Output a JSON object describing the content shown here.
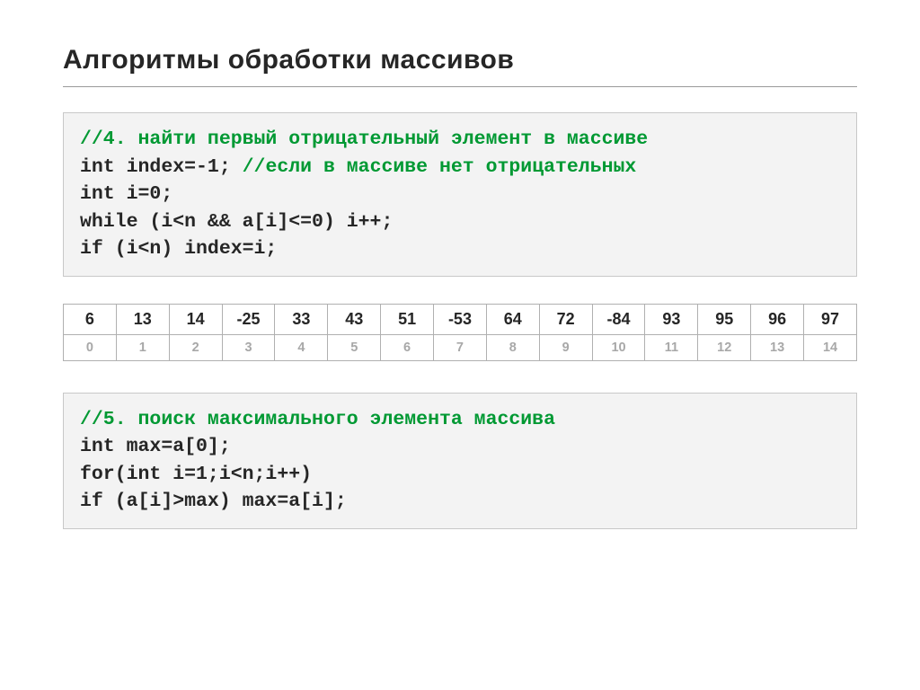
{
  "title": "Алгоритмы обработки массивов",
  "code_block_1": {
    "line1": {
      "comment": "//4. найти первый отрицательный элемент в массиве"
    },
    "line2": {
      "pre": "int index=-1; ",
      "comment": "//если в массиве нет отрицательных"
    },
    "line3": "int i=0;",
    "line4": "while (i<n && a[i]<=0) i++;",
    "line5": "if (i<n) index=i;"
  },
  "array_table": {
    "values": [
      "6",
      "13",
      "14",
      "-25",
      "33",
      "43",
      "51",
      "-53",
      "64",
      "72",
      "-84",
      "93",
      "95",
      "96",
      "97"
    ],
    "indices": [
      "0",
      "1",
      "2",
      "3",
      "4",
      "5",
      "6",
      "7",
      "8",
      "9",
      "10",
      "11",
      "12",
      "13",
      "14"
    ]
  },
  "code_block_2": {
    "line1": {
      "comment": "//5. поиск максимального элемента массива"
    },
    "line2": "int max=a[0];",
    "line3": "for(int i=1;i<n;i++)",
    "line4": "if (a[i]>max) max=a[i];"
  }
}
